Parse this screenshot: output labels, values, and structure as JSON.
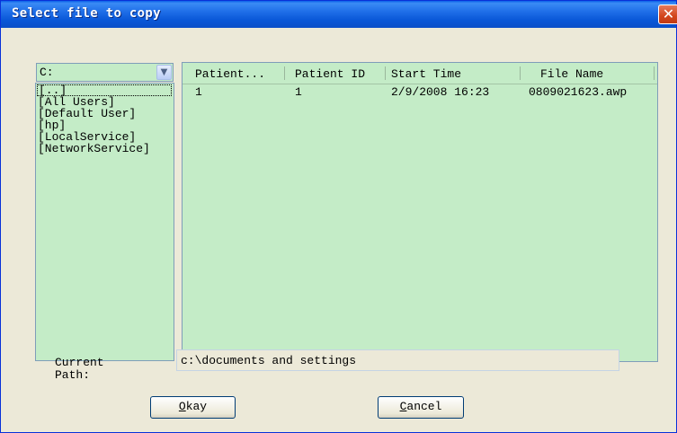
{
  "window": {
    "title": "Select file to copy",
    "close_symbol": "✕"
  },
  "drive_combo": {
    "selected": "C:",
    "arrow_symbol": "▼"
  },
  "directories": [
    "[..]",
    "[All Users]",
    "[Default User]",
    "[hp]",
    "[LocalService]",
    "[NetworkService]"
  ],
  "file_list": {
    "columns": [
      "Patient...",
      "Patient ID",
      "Start Time",
      "File Name"
    ],
    "rows": [
      [
        "1",
        "1",
        "2/9/2008 16:23",
        "0809021623.awp"
      ]
    ]
  },
  "current_path": {
    "label_line1": "Current",
    "label_line2": "Path:",
    "value": "c:\\documents and settings"
  },
  "buttons": {
    "okay_mnemonic": "O",
    "okay_rest": "kay",
    "cancel_mnemonic": "C",
    "cancel_rest": "ancel"
  }
}
